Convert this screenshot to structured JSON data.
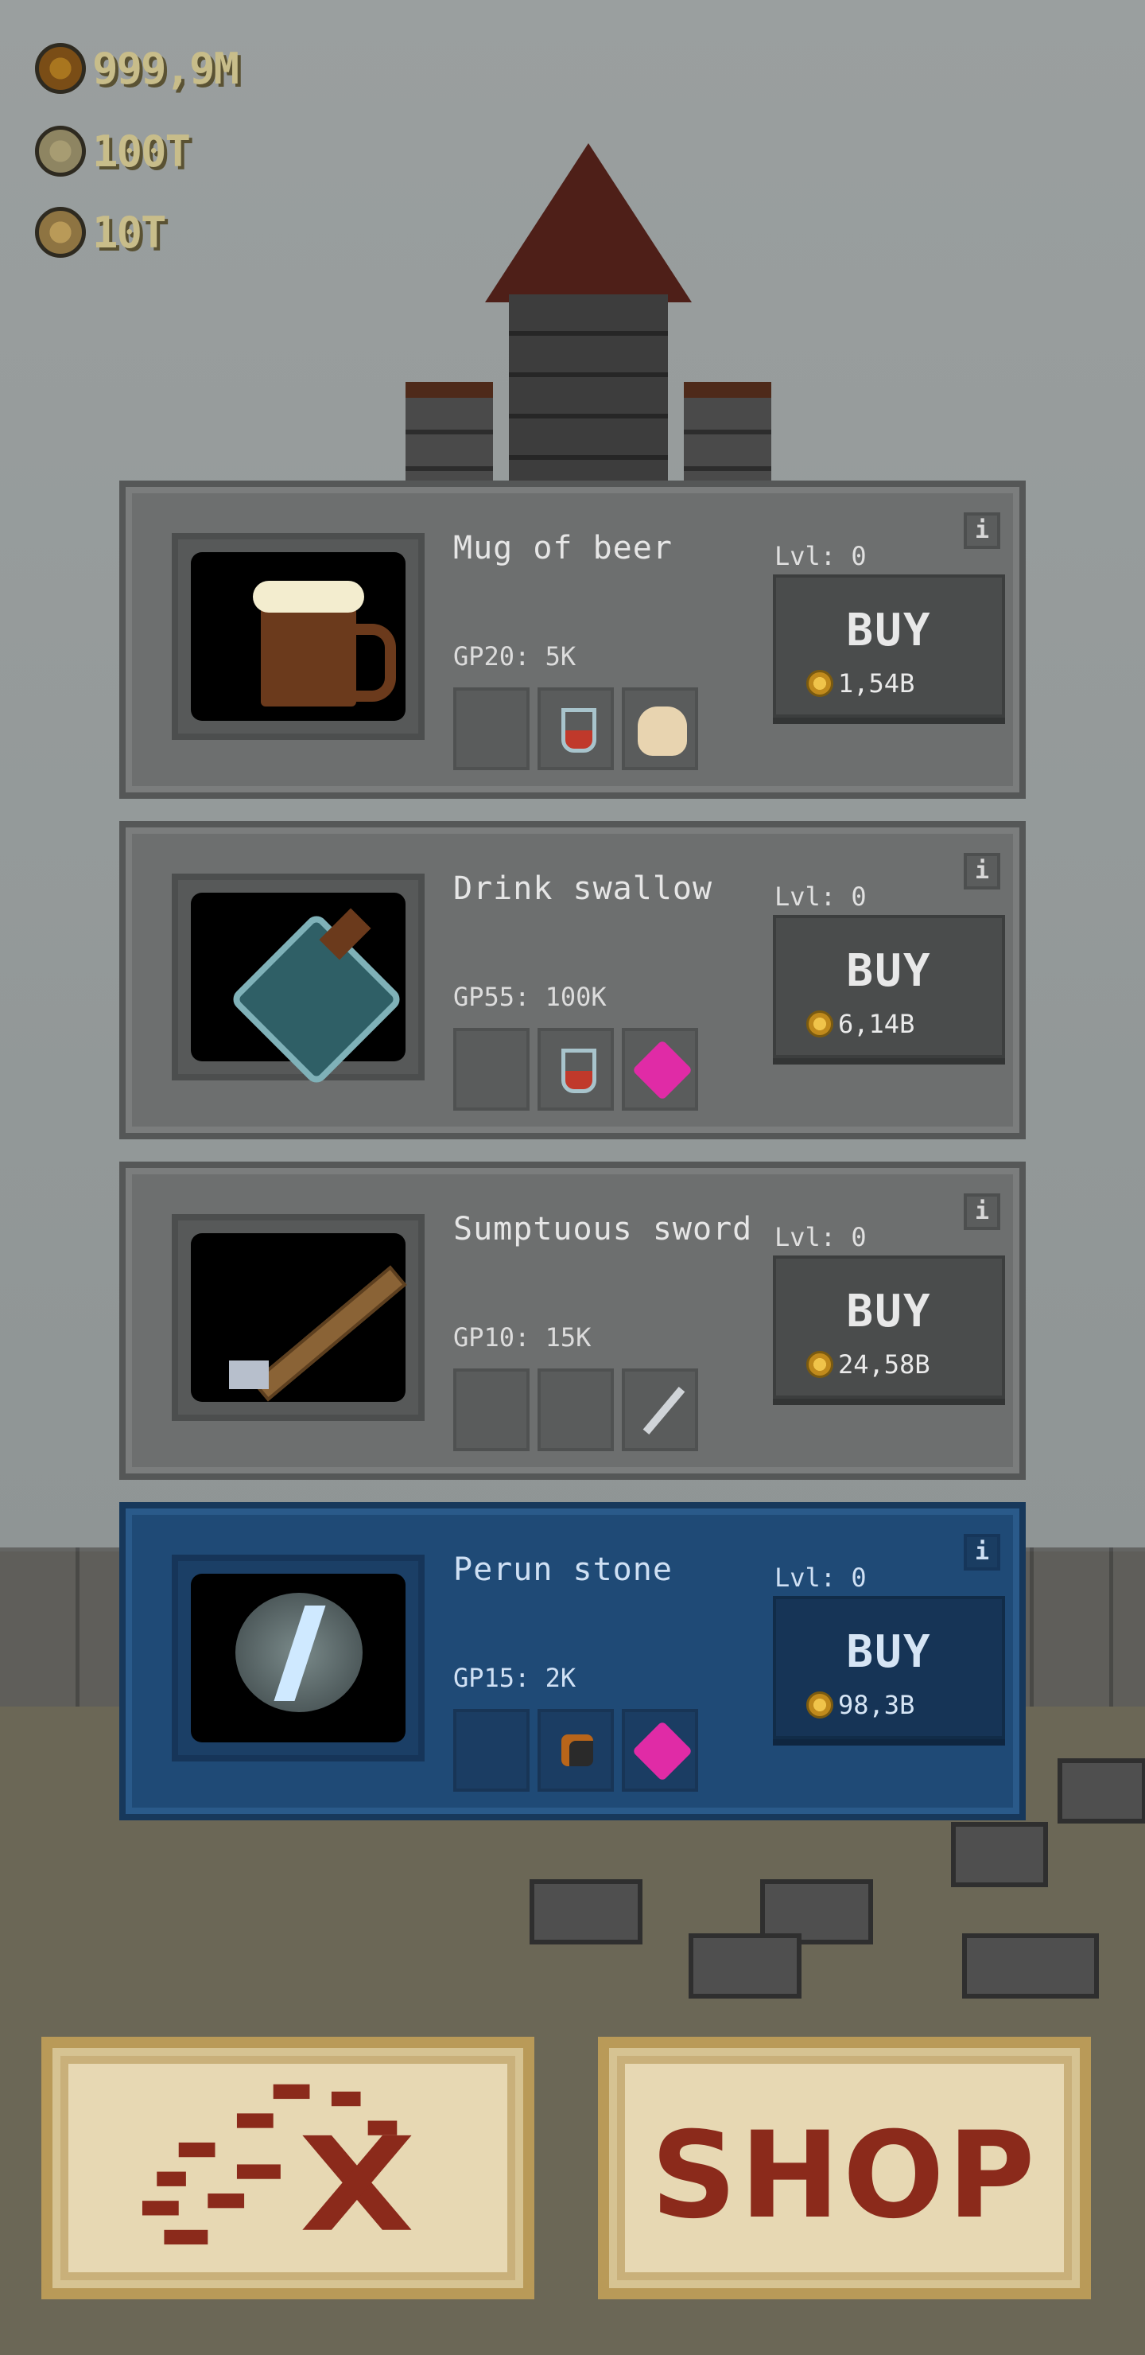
{
  "currencies": [
    {
      "icon": "gold-coin-icon",
      "value": "999,9M"
    },
    {
      "icon": "silver-gear-coin-icon",
      "value": "100T"
    },
    {
      "icon": "bronze-skull-coin-icon",
      "value": "10T"
    }
  ],
  "items": [
    {
      "name": "Mug of beer",
      "gp": "GP20: 5K",
      "level": "Lvl: 0",
      "buy": "BUY",
      "price": "1,54B",
      "selected": false
    },
    {
      "name": "Drink swallow",
      "gp": "GP55: 100K",
      "level": "Lvl: 0",
      "buy": "BUY",
      "price": "6,14B",
      "selected": false
    },
    {
      "name": "Sumptuous sword",
      "gp": "GP10: 15K",
      "level": "Lvl: 0",
      "buy": "BUY",
      "price": "24,58B",
      "selected": false
    },
    {
      "name": "Perun stone",
      "gp": "GP15: 2K",
      "level": "Lvl: 0",
      "buy": "BUY",
      "price": "98,3B",
      "selected": true
    }
  ],
  "info_glyph": "i",
  "bottom": {
    "map_icon": "treasure-map-icon",
    "shop_label": "SHOP"
  },
  "colors": {
    "selected_card": "#1f4a76",
    "card": "#6d6f6f",
    "shop_text": "#8b2a1b"
  }
}
